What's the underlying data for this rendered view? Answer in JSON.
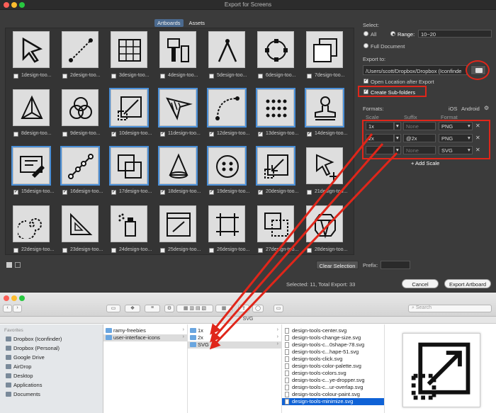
{
  "window": {
    "title": "Export for Screens"
  },
  "tabs": [
    {
      "label": "Artboards",
      "active": true
    },
    {
      "label": "Assets",
      "active": false
    }
  ],
  "artboards": [
    {
      "num": "1",
      "label": "design-too...",
      "checked": false,
      "selected": false,
      "icon": "cursor-icon"
    },
    {
      "num": "2",
      "label": "design-too...",
      "checked": false,
      "selected": false,
      "icon": "pen-line-icon"
    },
    {
      "num": "3",
      "label": "design-too...",
      "checked": false,
      "selected": false,
      "icon": "grid-icon"
    },
    {
      "num": "4",
      "label": "design-too...",
      "checked": false,
      "selected": false,
      "icon": "brush-icon"
    },
    {
      "num": "5",
      "label": "design-too...",
      "checked": false,
      "selected": false,
      "icon": "compass-icon"
    },
    {
      "num": "6",
      "label": "design-too...",
      "checked": false,
      "selected": false,
      "icon": "circle-anchor-icon"
    },
    {
      "num": "7",
      "label": "design-too...",
      "checked": false,
      "selected": false,
      "icon": "layers-icon"
    },
    {
      "num": "8",
      "label": "design-too...",
      "checked": false,
      "selected": false,
      "icon": "pyramid-icon"
    },
    {
      "num": "9",
      "label": "design-too...",
      "checked": false,
      "selected": false,
      "icon": "venn-icon"
    },
    {
      "num": "10",
      "label": "design-too...",
      "checked": true,
      "selected": true,
      "icon": "resize-icon"
    },
    {
      "num": "11",
      "label": "design-too...",
      "checked": true,
      "selected": true,
      "icon": "hatch-arrow-icon"
    },
    {
      "num": "12",
      "label": "design-too...",
      "checked": true,
      "selected": true,
      "icon": "curve-icon"
    },
    {
      "num": "13",
      "label": "design-too...",
      "checked": true,
      "selected": true,
      "icon": "dots-icon"
    },
    {
      "num": "14",
      "label": "design-too...",
      "checked": true,
      "selected": true,
      "icon": "stamp-icon"
    },
    {
      "num": "15",
      "label": "design-too...",
      "checked": true,
      "selected": true,
      "icon": "screen-edit-icon"
    },
    {
      "num": "16",
      "label": "design-too...",
      "checked": true,
      "selected": true,
      "icon": "path-nodes-icon"
    },
    {
      "num": "17",
      "label": "design-too...",
      "checked": true,
      "selected": true,
      "icon": "overlap-icon"
    },
    {
      "num": "18",
      "label": "design-too...",
      "checked": true,
      "selected": true,
      "icon": "cone-icon"
    },
    {
      "num": "19",
      "label": "design-too...",
      "checked": true,
      "selected": true,
      "icon": "button-icon"
    },
    {
      "num": "20",
      "label": "design-too...",
      "checked": true,
      "selected": true,
      "icon": "minimize-icon"
    },
    {
      "num": "21",
      "label": "design-too...",
      "checked": false,
      "selected": false,
      "icon": "select-arrow-icon"
    },
    {
      "num": "22",
      "label": "design-too...",
      "checked": false,
      "selected": false,
      "icon": "spiral-icon"
    },
    {
      "num": "23",
      "label": "design-too...",
      "checked": false,
      "selected": false,
      "icon": "triangle-ruler-icon"
    },
    {
      "num": "24",
      "label": "design-too...",
      "checked": false,
      "selected": false,
      "icon": "spray-icon"
    },
    {
      "num": "25",
      "label": "design-too...",
      "checked": false,
      "selected": false,
      "icon": "window-pen-icon"
    },
    {
      "num": "26",
      "label": "design-too...",
      "checked": false,
      "selected": false,
      "icon": "crop-icon"
    },
    {
      "num": "27",
      "label": "design-too...",
      "checked": false,
      "selected": false,
      "icon": "dashed-square-icon"
    },
    {
      "num": "28",
      "label": "design-too...",
      "checked": false,
      "selected": false,
      "icon": "gem-icon"
    }
  ],
  "select": {
    "label": "Select:",
    "all_label": "All",
    "range_label": "Range:",
    "range_value": "10~20",
    "full_doc_label": "Full Document"
  },
  "export_to": {
    "label": "Export to:",
    "path": "/Users/scott/Dropbox/Dropbox (Iconfinde",
    "open_after_label": "Open Location after Export",
    "open_after_checked": true,
    "subfolders_label": "Create Sub-folders",
    "subfolders_checked": true
  },
  "formats": {
    "label": "Formats:",
    "ios": "iOS",
    "android": "Android",
    "col_scale": "Scale",
    "col_suffix": "Suffix",
    "col_format": "Format",
    "rows": [
      {
        "scale": "1x",
        "suffix": "None",
        "format": "PNG"
      },
      {
        "scale": "2x",
        "suffix": "@2x",
        "format": "PNG"
      },
      {
        "scale": "",
        "suffix": "None",
        "format": "SVG"
      }
    ],
    "add_scale": "+ Add Scale"
  },
  "bottom": {
    "clear_selection": "Clear Selection",
    "prefix_label": "Prefix:",
    "status": "Selected: 11, Total Export: 33",
    "cancel": "Cancel",
    "export": "Export Artboard"
  },
  "finder": {
    "path_title": "SVG",
    "search_placeholder": "Search",
    "favorites_label": "Favorites",
    "sidebar": [
      "Dropbox (Iconfinder)",
      "Dropbox (Personal)",
      "Google Drive",
      "AirDrop",
      "Desktop",
      "Applications",
      "Documents"
    ],
    "col1": [
      "ramy-freebies",
      "user-interface-icons"
    ],
    "col2": [
      "1x",
      "2x",
      "SVG"
    ],
    "col3": [
      "design-tools-center.svg",
      "design-tools-change-size.svg",
      "design-tools-c...0shape-78.svg",
      "design-tools-c...hape-51.svg",
      "design-tools-click.svg",
      "design-tools-color-palette.svg",
      "design-tools-colors.svg",
      "design-tools-c...ye-dropper.svg",
      "design-tools-c...ur-overlap.svg",
      "design-tools-colour-paint.svg",
      "design-tools-minimize.svg"
    ]
  },
  "colors": {
    "accent": "#4a90d9",
    "annotation": "#e0261a",
    "finder_selection": "#0f62d6"
  }
}
